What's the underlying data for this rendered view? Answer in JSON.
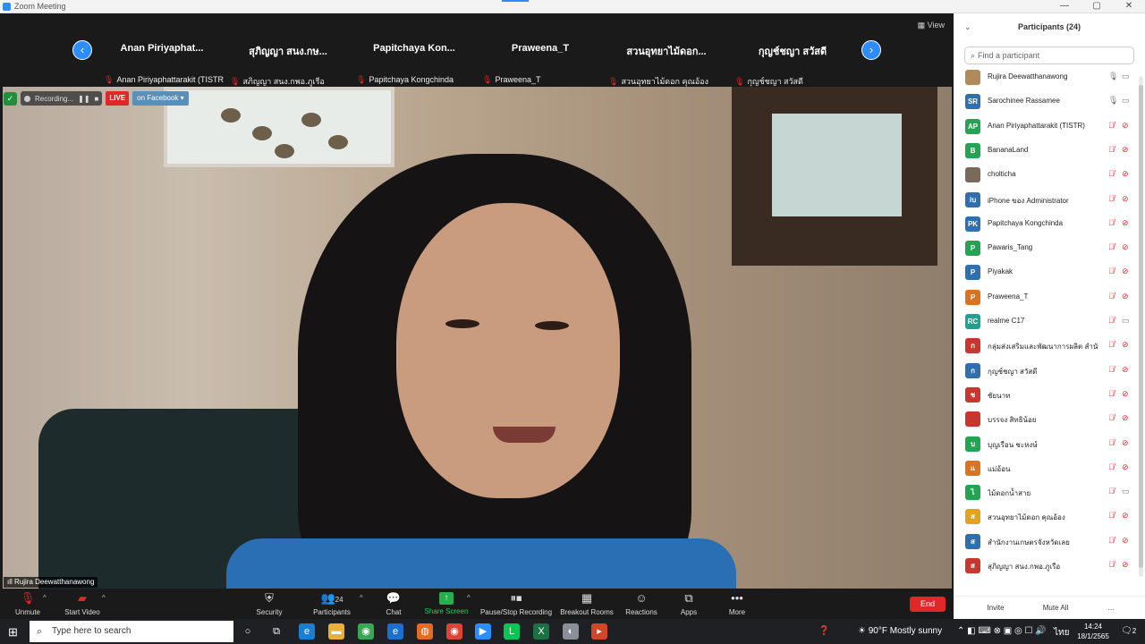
{
  "window": {
    "title": "Zoom Meeting",
    "controls": [
      "—",
      "▢",
      "✕"
    ]
  },
  "strip": {
    "view_label": "View",
    "prev_icon": "‹",
    "next_icon": "›",
    "thumbs": [
      {
        "big": "Anan  Piriyaphat...",
        "small": "Anan Piriyaphattarakit (TISTR)"
      },
      {
        "big": "สุภิญญา  สนง.กษ...",
        "small": "สภิญญา  สนง.กพอ.ภูเรือ"
      },
      {
        "big": "Papitchaya  Kon...",
        "small": "Papitchaya Kongchinda"
      },
      {
        "big": "Praweena_T",
        "small": "Praweena_T"
      },
      {
        "big": "สวนอุทยาไม้ดอก...",
        "small": "สวนอุทยาไม้ดอก คุณอ้อง"
      },
      {
        "big": "กุญช์ชญา สวัสดี",
        "small": "กุญช์ชญา สวัสดี"
      }
    ]
  },
  "recording": {
    "label": "Recording...",
    "live": "LIVE",
    "facebook": "on Facebook"
  },
  "speaker": {
    "name": "Rujira Deewatthanawong"
  },
  "toolbar": {
    "unmute": "Unmute",
    "start_video": "Start Video",
    "security": "Security",
    "participants": "Participants",
    "participants_count": "24",
    "chat": "Chat",
    "share_screen": "Share Screen",
    "pause_stop": "Pause/Stop Recording",
    "breakout": "Breakout Rooms",
    "reactions": "Reactions",
    "apps": "Apps",
    "more": "More",
    "end": "End"
  },
  "panel": {
    "title": "Participants (24)",
    "search_placeholder": "Find a participant",
    "invite": "Invite",
    "mute_all": "Mute All",
    "more": "...",
    "participants": [
      {
        "name": "Rujira Deewatthanawong",
        "initials": "",
        "color": "#b08a5a",
        "mic": "on",
        "video": "on"
      },
      {
        "name": "Sarochinee Rassamee",
        "initials": "SR",
        "color": "#2f6fb0",
        "mic": "on",
        "video": "on"
      },
      {
        "name": "Anan Piriyaphattarakit (TISTR)",
        "initials": "AP",
        "color": "#23a455",
        "mic": "muted",
        "video": "off"
      },
      {
        "name": "BananaLand",
        "initials": "B",
        "color": "#23a455",
        "mic": "muted",
        "video": "off"
      },
      {
        "name": "cholticha",
        "initials": "",
        "color": "#7a6a5a",
        "mic": "muted",
        "video": "off"
      },
      {
        "name": "iPhone ของ Administrator",
        "initials": "iบ",
        "color": "#2f6fb0",
        "mic": "muted",
        "video": "off"
      },
      {
        "name": "Papitchaya Kongchinda",
        "initials": "PK",
        "color": "#2f6fb0",
        "mic": "muted",
        "video": "off"
      },
      {
        "name": "Pawaris_Tang",
        "initials": "P",
        "color": "#23a455",
        "mic": "muted",
        "video": "off"
      },
      {
        "name": "Piyakak",
        "initials": "P",
        "color": "#2f6fb0",
        "mic": "muted",
        "video": "off"
      },
      {
        "name": "Praweena_T",
        "initials": "P",
        "color": "#d9731f",
        "mic": "muted",
        "video": "off"
      },
      {
        "name": "realme C17",
        "initials": "RC",
        "color": "#1fa38f",
        "mic": "muted",
        "video": "on"
      },
      {
        "name": "กลุ่มส่งเสริมและพัฒนาการผลิต สำนั�",
        "initials": "ก",
        "color": "#c7372f",
        "mic": "muted",
        "video": "off"
      },
      {
        "name": "กุญช์ชญา สวัสดี",
        "initials": "ก",
        "color": "#2f6fb0",
        "mic": "muted",
        "video": "off"
      },
      {
        "name": "ชัยนาท",
        "initials": "ช",
        "color": "#c7372f",
        "mic": "muted",
        "video": "off"
      },
      {
        "name": "บรรจง สิทธิน้อย",
        "initials": "",
        "color": "#c7372f",
        "mic": "muted",
        "video": "off"
      },
      {
        "name": "บุญเรือน ชะหงษ์",
        "initials": "บ",
        "color": "#23a455",
        "mic": "muted",
        "video": "off"
      },
      {
        "name": "แม่อ้อน",
        "initials": "แ",
        "color": "#d9731f",
        "mic": "muted",
        "video": "off"
      },
      {
        "name": "ไม้ดอกน้ำสาย",
        "initials": "ไ",
        "color": "#23a455",
        "mic": "muted",
        "video": "on"
      },
      {
        "name": "สวนอุทยาไม้ดอก คุณอ้อง",
        "initials": "ส",
        "color": "#e0a21f",
        "mic": "muted",
        "video": "off"
      },
      {
        "name": "สำนักงานเกษตรจังหวัดเลย",
        "initials": "ส",
        "color": "#2f6fb0",
        "mic": "muted",
        "video": "off"
      },
      {
        "name": "สุภิญญา  สนง.กพอ.ภูเรือ",
        "initials": "ส",
        "color": "#c7372f",
        "mic": "muted",
        "video": "off"
      }
    ]
  },
  "taskbar": {
    "search_placeholder": "Type here to search",
    "weather": "90°F  Mostly sunny",
    "lang": "ไทย",
    "time": "14:24",
    "date": "18/1/2565",
    "notifications": "2"
  }
}
